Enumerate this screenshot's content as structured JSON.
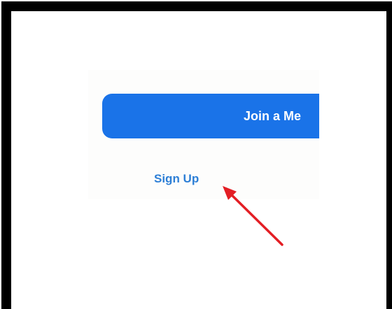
{
  "join_button": {
    "label": "Join a Me"
  },
  "signup": {
    "label": "Sign Up"
  },
  "colors": {
    "frame": "#000000",
    "button": "#1a73e8",
    "link": "#2d7fd6",
    "arrow": "#e31e24"
  }
}
